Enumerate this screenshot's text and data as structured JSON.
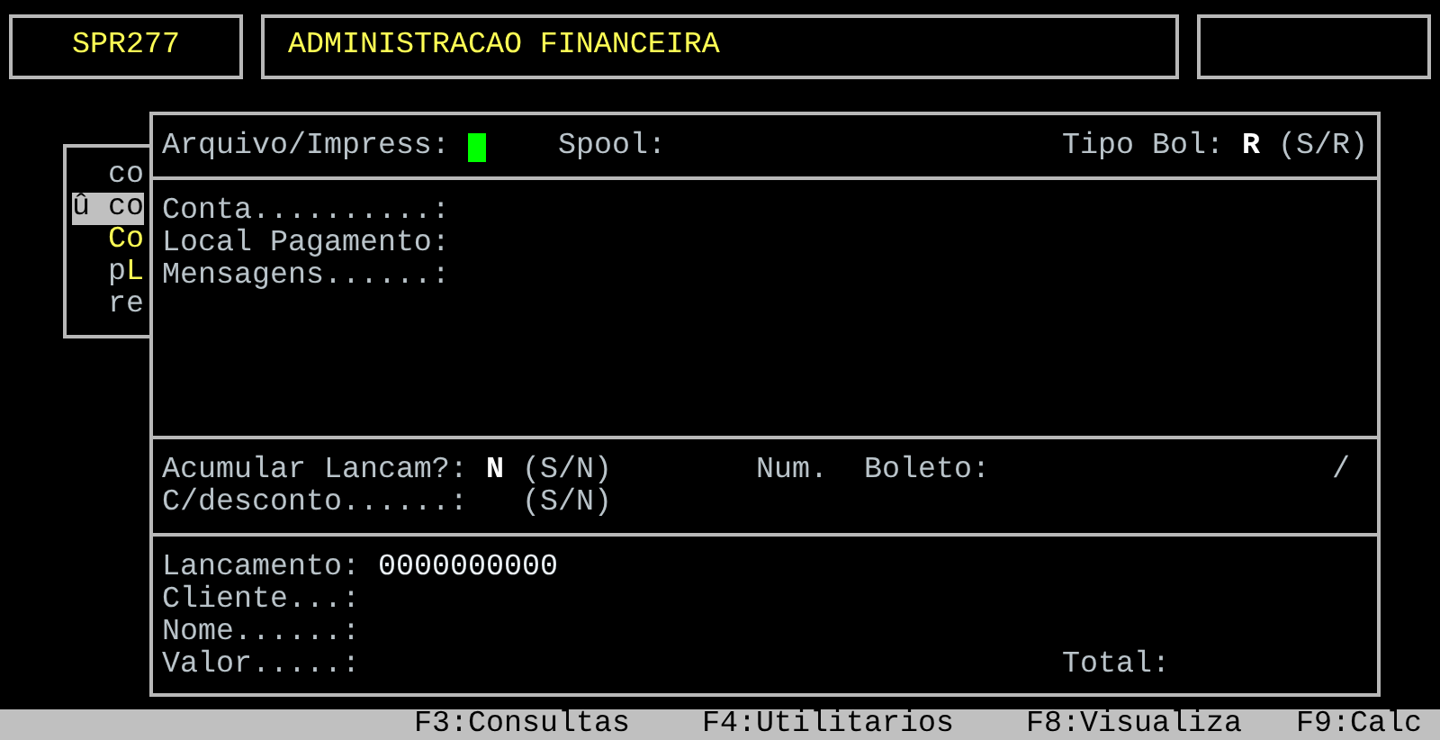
{
  "header": {
    "program_code": "SPR277",
    "system_title": "ADMINISTRACAO FINANCEIRA"
  },
  "background_menu": {
    "items": [
      {
        "parts": [
          {
            "text": "co",
            "hotkey": false
          }
        ],
        "selected": false
      },
      {
        "parts": [
          {
            "text": "û co",
            "hotkey": false
          }
        ],
        "selected": true
      },
      {
        "parts": [
          {
            "text": "Co",
            "hotkey": true
          }
        ],
        "selected": false
      },
      {
        "parts": [
          {
            "text": "p",
            "hotkey": false
          },
          {
            "text": "L",
            "hotkey": true
          }
        ],
        "selected": false
      },
      {
        "parts": [
          {
            "text": "re",
            "hotkey": false
          }
        ],
        "selected": false
      }
    ]
  },
  "form": {
    "output_row": {
      "arquivo_label": "Arquivo/Impress:",
      "arquivo_focused": true,
      "spool_label": "Spool:",
      "tipo_bol_label": "Tipo Bol:",
      "tipo_bol_value": "R",
      "tipo_bol_hint": "(S/R)"
    },
    "boleto_fields": [
      {
        "label": "Conta..........:"
      },
      {
        "label": "Local Pagamento:"
      },
      {
        "label": "Mensagens......:"
      }
    ],
    "options": {
      "acumular_label": "Acumular Lancam?:",
      "acumular_value": "N",
      "acumular_hint": "(S/N)",
      "num_label": "Num.",
      "boleto_label": "Boleto:",
      "boleto_separator": "/",
      "desconto_label": "C/desconto......:",
      "desconto_hint": "(S/N)"
    },
    "lancamento": {
      "lancamento_label": "Lancamento:",
      "lancamento_value": "0000000000",
      "cliente_label": "Cliente...:",
      "nome_label": "Nome......:",
      "valor_label": "Valor.....:",
      "total_label": "Total:"
    }
  },
  "status_bar": {
    "keys": [
      "F3:Consultas",
      "F4:Utilitarios",
      "F8:Visualiza",
      "F9:Calc"
    ]
  }
}
